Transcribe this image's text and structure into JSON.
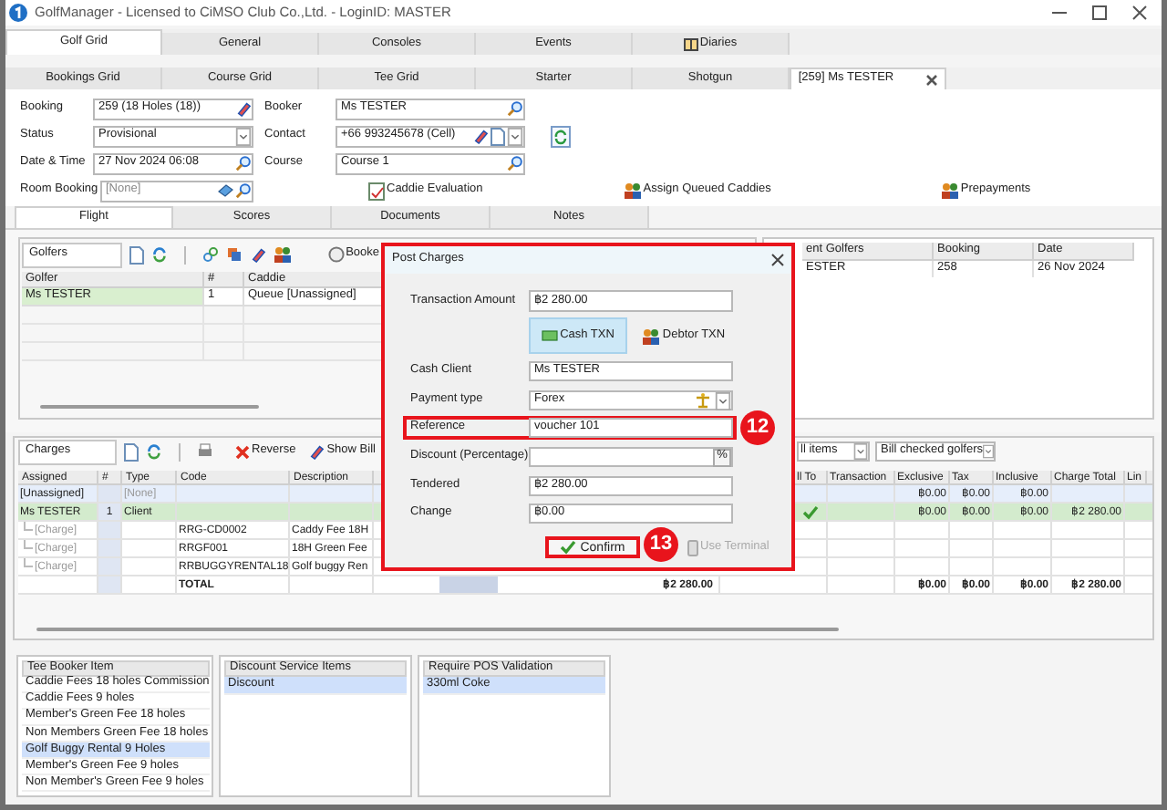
{
  "window": {
    "title": "GolfManager - Licensed to CiMSO Club Co.,Ltd. - LoginID: MASTER"
  },
  "main_tabs": [
    {
      "label": "Golf Grid",
      "selected": true
    },
    {
      "label": "General",
      "selected": false
    },
    {
      "label": "Consoles",
      "selected": false
    },
    {
      "label": "Events",
      "selected": false
    },
    {
      "label": "Diaries",
      "selected": false
    }
  ],
  "sub_tabs": [
    {
      "label": "Bookings Grid",
      "selected": false
    },
    {
      "label": "Course Grid",
      "selected": false
    },
    {
      "label": "Tee Grid",
      "selected": false
    },
    {
      "label": "Starter",
      "selected": false
    },
    {
      "label": "Shotgun",
      "selected": false
    },
    {
      "label": "[259] Ms TESTER",
      "selected": true
    }
  ],
  "booking_form": {
    "booking_label": "Booking",
    "booking": "259 (18 Holes (18))",
    "status_label": "Status",
    "status": "Provisional",
    "date_label": "Date & Time",
    "date_time": "27 Nov 2024 06:08",
    "room_label": "Room Booking",
    "room_booking": "[None]",
    "booker_label": "Booker",
    "booker": "Ms TESTER",
    "contact_label": "Contact",
    "contact": "+66 993245678 (Cell)",
    "course_label": "Course",
    "course": "Course 1",
    "actions": [
      "Caddie Evaluation",
      "Assign Queued Caddies",
      "Prepayments"
    ]
  },
  "detail_tabs": [
    {
      "label": "Flight",
      "selected": true
    },
    {
      "label": "Scores",
      "selected": false
    },
    {
      "label": "Documents",
      "selected": false
    },
    {
      "label": "Notes",
      "selected": false
    }
  ],
  "golfers": {
    "title": "Golfers",
    "bookings_button": "Booke",
    "columns": [
      "Golfer",
      "#",
      "Caddie"
    ],
    "rows": [
      {
        "golfer": "Ms TESTER",
        "number": "1",
        "caddie": "Queue [Unassigned]",
        "selected": true
      }
    ]
  },
  "other_golfers": {
    "columns": [
      "ent Golfers",
      "Booking",
      "Date"
    ],
    "rows": [
      {
        "golfer": "ESTER",
        "booking": "258",
        "date": "26 Nov 2024"
      }
    ]
  },
  "charges": {
    "title": "Charges",
    "reverse_button": "Reverse",
    "show_bill_button": "Show Bill",
    "filters": [
      "ll items",
      "Bill checked golfers"
    ],
    "columns_left": [
      "Assigned",
      "#",
      "Type",
      "Code",
      "Description"
    ],
    "columns_right": [
      "ll To",
      "Transaction",
      "Exclusive",
      "Tax",
      "Inclusive",
      "Charge Total",
      "Lin"
    ],
    "rows": [
      {
        "kind": "group",
        "assigned": "[Unassigned]",
        "type": "[None]",
        "checked": false,
        "exclusive": "฿0.00",
        "tax": "฿0.00",
        "inclusive": "฿0.00"
      },
      {
        "kind": "golfer",
        "assigned": "Ms TESTER",
        "number": "1",
        "type": "Client",
        "checked": true,
        "exclusive": "฿0.00",
        "tax": "฿0.00",
        "inclusive": "฿0.00",
        "charge_total": "฿2 280.00"
      },
      {
        "kind": "charge",
        "assigned": "[Charge]",
        "code": "RRG-CD0002",
        "description": "Caddy Fee 18H",
        "checked": false
      },
      {
        "kind": "charge",
        "assigned": "[Charge]",
        "code": "RRGF001",
        "description": "18H Green Fee",
        "checked": false
      },
      {
        "kind": "charge",
        "assigned": "[Charge]",
        "code": "RRBUGGYRENTAL18",
        "description": "Golf buggy Ren",
        "checked": false
      },
      {
        "kind": "total",
        "code": "TOTAL",
        "amount": "฿2 280.00",
        "checked": false,
        "exclusive": "฿0.00",
        "tax": "฿0.00",
        "inclusive": "฿0.00",
        "charge_total": "฿2 280.00"
      }
    ]
  },
  "lists": [
    {
      "title": "Tee Booker Item",
      "items": [
        {
          "label": "Caddie Fees 18 holes Commission",
          "selected": false
        },
        {
          "label": "Caddie Fees 9 holes",
          "selected": false
        },
        {
          "label": "Member's Green Fee 18 holes",
          "selected": false
        },
        {
          "label": "Non Members Green Fee 18 holes",
          "selected": false
        },
        {
          "label": "Golf Buggy Rental 9 Holes",
          "selected": true
        },
        {
          "label": "Member's Green Fee 9 holes",
          "selected": false
        },
        {
          "label": "Non Member's Green Fee 9 holes",
          "selected": false
        }
      ]
    },
    {
      "title": "Discount Service Items",
      "items": [
        {
          "label": "Discount",
          "selected": true
        }
      ]
    },
    {
      "title": "Require POS Validation",
      "items": [
        {
          "label": "330ml Coke",
          "selected": true
        }
      ]
    }
  ],
  "dialog": {
    "title": "Post Charges",
    "amount_label": "Transaction Amount",
    "amount": "฿2 280.00",
    "txn_buttons": [
      {
        "label": "Cash TXN",
        "selected": true
      },
      {
        "label": "Debtor TXN",
        "selected": false
      }
    ],
    "fields": [
      {
        "kind": "text",
        "label": "Cash Client",
        "value": "Ms TESTER",
        "highlighted": false
      },
      {
        "kind": "dropdown",
        "label": "Payment type",
        "value": "Forex",
        "highlighted": false
      },
      {
        "kind": "text",
        "label": "Reference",
        "value": "voucher 101",
        "highlighted": true,
        "callout": "12"
      },
      {
        "kind": "percent",
        "label": "Discount (Percentage)",
        "button": "%",
        "highlighted": false
      },
      {
        "kind": "text",
        "label": "Tendered",
        "value": "฿2 280.00",
        "highlighted": false
      },
      {
        "kind": "text",
        "label": "Change",
        "value": "฿0.00",
        "highlighted": false
      }
    ],
    "confirm": {
      "label": "Confirm",
      "highlighted": true,
      "callout": "13"
    },
    "use_terminal": {
      "label": "Use Terminal",
      "disabled": true
    }
  }
}
